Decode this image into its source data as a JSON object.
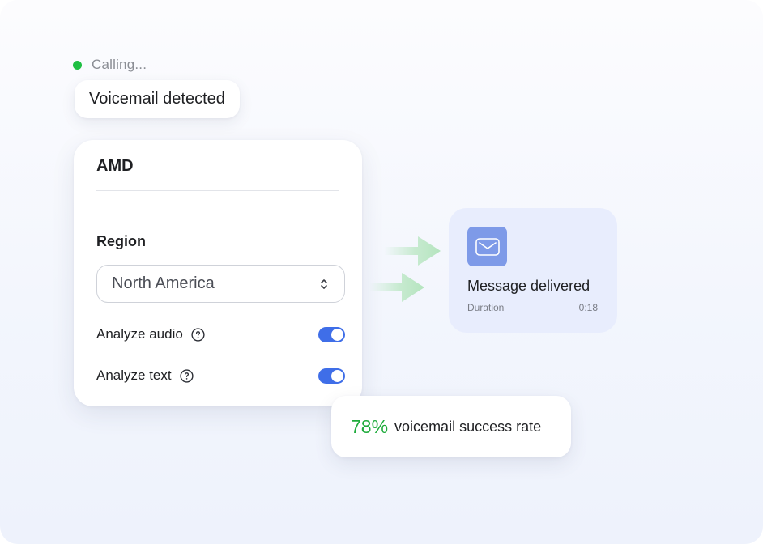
{
  "status": {
    "text": "Calling...",
    "color": "#1fbf43"
  },
  "detection": {
    "label": "Voicemail detected"
  },
  "amd_card": {
    "title": "AMD",
    "region": {
      "label": "Region",
      "selected": "North America"
    },
    "toggles": [
      {
        "label": "Analyze audio",
        "enabled": true
      },
      {
        "label": "Analyze text",
        "enabled": true
      }
    ]
  },
  "message": {
    "icon": "mail-icon",
    "title": "Message delivered",
    "duration_label": "Duration",
    "duration_value": "0:18"
  },
  "rate": {
    "value": "78%",
    "label": "voicemail success rate",
    "color": "#1fab3c"
  },
  "colors": {
    "accent": "#3f6ee8",
    "arrow": "#bfe8c8",
    "message_bg": "#e8edfd"
  }
}
